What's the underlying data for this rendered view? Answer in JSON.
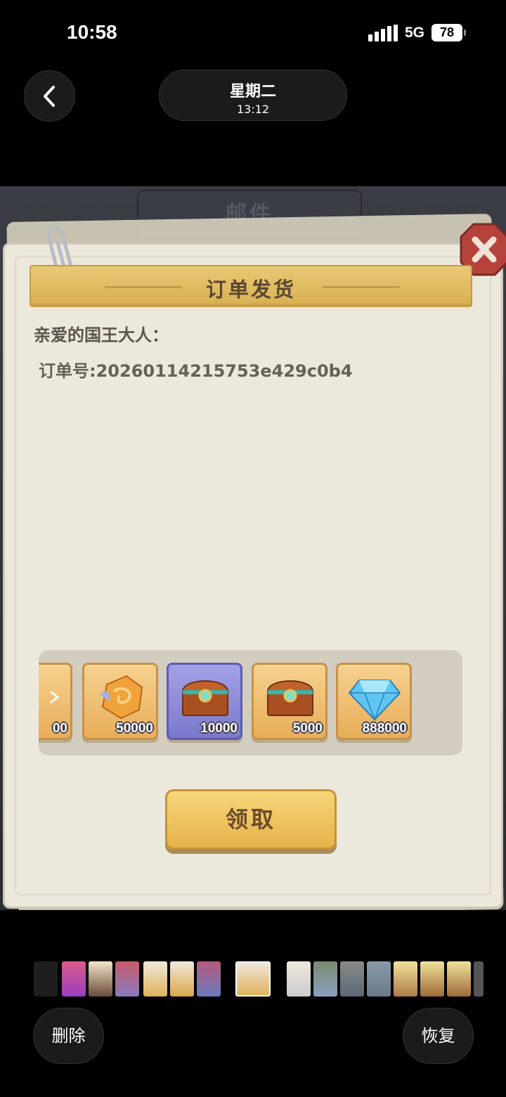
{
  "status_bar": {
    "time": "10:58",
    "network": "5G",
    "battery": "78"
  },
  "nav": {
    "day": "星期二",
    "time": "13:12"
  },
  "game": {
    "tab_label": "邮件",
    "mail_title": "订单发货",
    "greeting": "亲爱的国王大人：",
    "order_number": "订单号:20260114215753e429c0b4",
    "claim_label": "领取",
    "rewards": [
      {
        "icon": "partial-item-icon",
        "qty": "00",
        "frame": "orange"
      },
      {
        "icon": "ore-stone-icon",
        "qty": "50000",
        "frame": "orange"
      },
      {
        "icon": "treasure-chest-icon",
        "qty": "10000",
        "frame": "purple"
      },
      {
        "icon": "treasure-chest-icon",
        "qty": "5000",
        "frame": "orange"
      },
      {
        "icon": "diamond-icon",
        "qty": "888000",
        "frame": "orange"
      }
    ]
  },
  "bottom": {
    "delete_label": "删除",
    "restore_label": "恢复"
  },
  "colors": {
    "gold": "#e6b24a",
    "paper": "#ede8dc",
    "close_red": "#b5433b"
  }
}
